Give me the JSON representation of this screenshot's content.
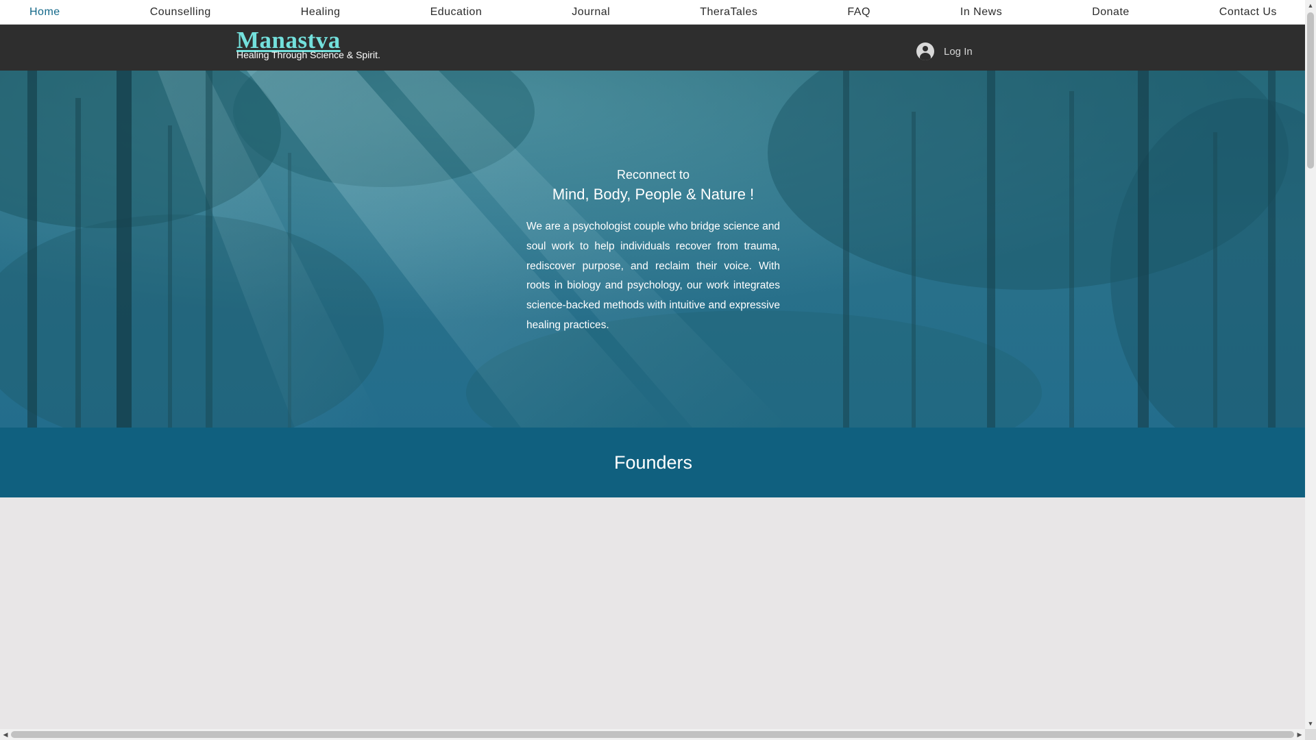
{
  "nav": {
    "items": [
      {
        "label": "Home",
        "active": true
      },
      {
        "label": "Counselling",
        "active": false
      },
      {
        "label": "Healing",
        "active": false
      },
      {
        "label": "Education",
        "active": false
      },
      {
        "label": "Journal",
        "active": false
      },
      {
        "label": "TheraTales",
        "active": false
      },
      {
        "label": "FAQ",
        "active": false
      },
      {
        "label": "In News",
        "active": false
      },
      {
        "label": "Donate",
        "active": false
      },
      {
        "label": "Contact Us",
        "active": false
      }
    ]
  },
  "header": {
    "brand": "Manastva",
    "tagline": "Healing Through Science & Spirit.",
    "login_label": "Log In",
    "login_icon": "user-avatar-icon"
  },
  "hero": {
    "kicker": "Reconnect to",
    "heading": "Mind, Body, People & Nature !",
    "body": "We are a psychologist couple who bridge science and soul work to help individuals recover from trauma, rediscover purpose, and reclaim their voice. With roots in biology and psychology, our work integrates science-backed methods with intuitive and expressive healing practices."
  },
  "founders": {
    "title": "Founders"
  },
  "colors": {
    "brand_accent": "#73e0dc",
    "nav_active": "#116788",
    "header_bg": "#2e2e2e",
    "founders_band": "#10607f",
    "hero_teal": "#2a7189",
    "page_bg": "#e8e6e7"
  }
}
